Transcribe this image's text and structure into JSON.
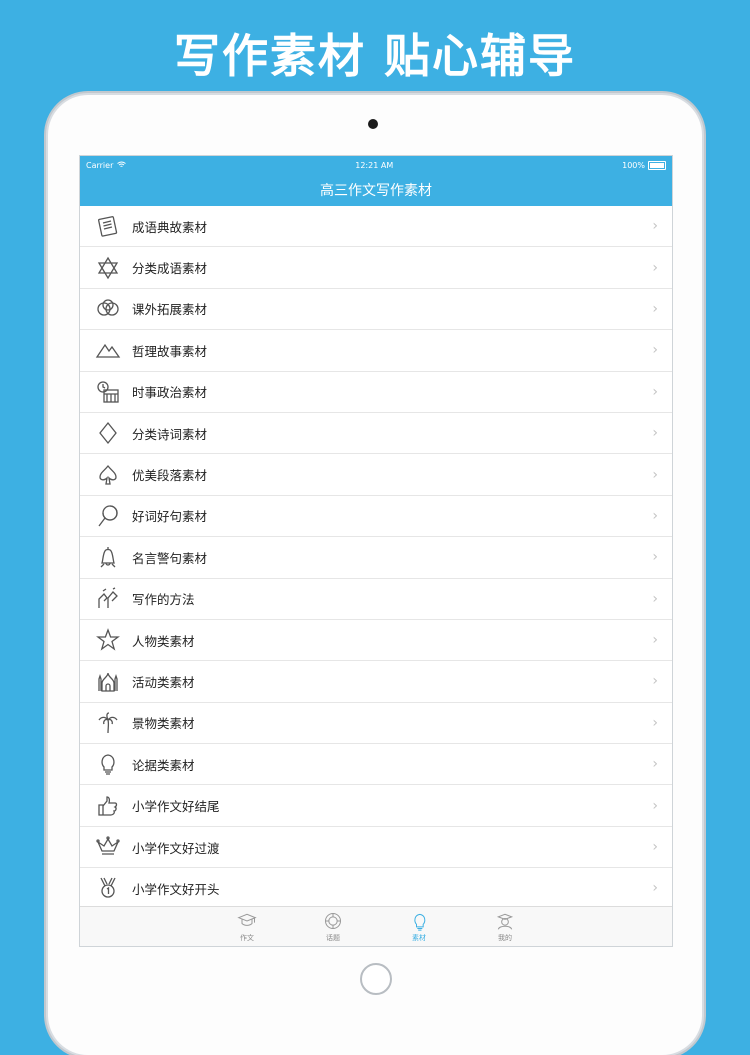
{
  "banner": {
    "title": "写作素材 贴心辅导"
  },
  "status_bar": {
    "carrier": "Carrier",
    "time": "12:21 AM",
    "battery": "100%"
  },
  "nav": {
    "title": "高三作文写作素材"
  },
  "list": [
    {
      "label": "成语典故素材",
      "icon": "book-icon"
    },
    {
      "label": "分类成语素材",
      "icon": "star-of-david-icon"
    },
    {
      "label": "课外拓展素材",
      "icon": "rings-icon"
    },
    {
      "label": "哲理故事素材",
      "icon": "mountains-icon"
    },
    {
      "label": "时事政治素材",
      "icon": "clock-calendar-icon"
    },
    {
      "label": "分类诗词素材",
      "icon": "diamond-icon"
    },
    {
      "label": "优美段落素材",
      "icon": "spade-icon"
    },
    {
      "label": "好词好句素材",
      "icon": "lollipop-icon"
    },
    {
      "label": "名言警句素材",
      "icon": "bell-icon"
    },
    {
      "label": "写作的方法",
      "icon": "hands-icon"
    },
    {
      "label": "人物类素材",
      "icon": "star-icon"
    },
    {
      "label": "活动类素材",
      "icon": "mosque-icon"
    },
    {
      "label": "景物类素材",
      "icon": "palm-tree-icon"
    },
    {
      "label": "论据类素材",
      "icon": "lightbulb-icon"
    },
    {
      "label": "小学作文好结尾",
      "icon": "thumbs-up-icon"
    },
    {
      "label": "小学作文好过渡",
      "icon": "crown-icon"
    },
    {
      "label": "小学作文好开头",
      "icon": "medal-icon"
    }
  ],
  "tabs": [
    {
      "label": "作文",
      "icon": "graduation-cap-icon",
      "active": false
    },
    {
      "label": "话题",
      "icon": "gear-badge-icon",
      "active": false
    },
    {
      "label": "素材",
      "icon": "lightbulb-icon",
      "active": true
    },
    {
      "label": "我的",
      "icon": "user-cap-icon",
      "active": false
    }
  ],
  "colors": {
    "accent": "#3db0e3",
    "chevron": "#c4c4c4"
  }
}
